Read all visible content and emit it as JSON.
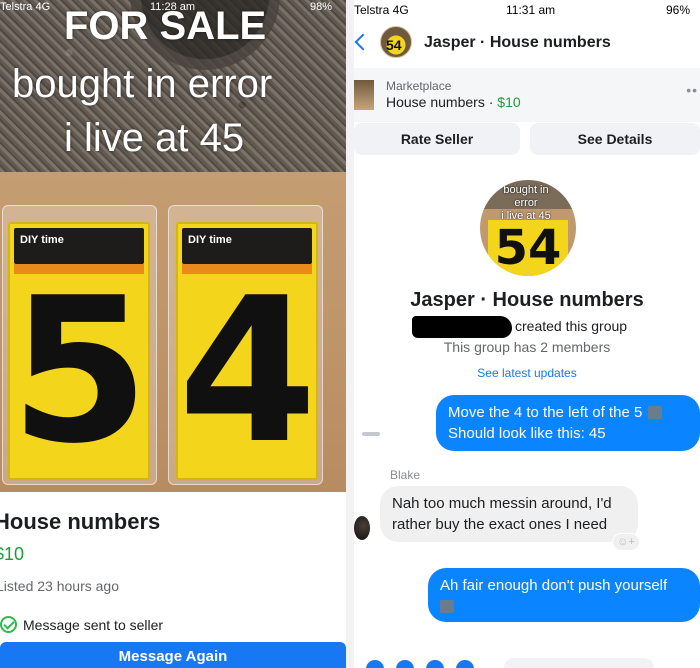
{
  "left": {
    "status": {
      "carrier": "Telstra 4G",
      "time": "11:28 am",
      "battery": "98%"
    },
    "photo_overlay": {
      "line1": "FOR SALE",
      "line2": "bought in error",
      "line3": "i live at 45"
    },
    "packs": [
      {
        "brand": "DIY time",
        "digit": "5"
      },
      {
        "brand": "DIY time",
        "digit": "4"
      }
    ],
    "listing": {
      "title": "House numbers",
      "price": "$10",
      "listed": "Listed 23 hours ago",
      "sent_status": "Message sent to seller",
      "message_again_label": "Message Again"
    }
  },
  "right": {
    "status": {
      "carrier": "Telstra 4G",
      "time": "11:31 am",
      "battery": "96%"
    },
    "header": {
      "title": "Jasper · House numbers"
    },
    "marketplace": {
      "label": "Marketplace",
      "item": "House numbers",
      "separator": "·",
      "price": "$10"
    },
    "buttons": {
      "rate_seller": "Rate Seller",
      "see_details": "See Details"
    },
    "group_avatar_text": {
      "line1": "bought in error",
      "line2": "i live at 45",
      "digits": "54"
    },
    "group": {
      "name": "Jasper · House numbers",
      "created": "created this group",
      "members": "This group has 2 members",
      "updates": "See latest updates"
    },
    "messages": [
      {
        "from": "me",
        "lines": [
          "Move the 4 to the left of the 5",
          "Should look like this: 45"
        ]
      },
      {
        "from": "Blake",
        "sender_label": "Blake",
        "lines": [
          "Nah too much messin around, I'd",
          "rather buy the exact ones I need"
        ]
      },
      {
        "from": "me",
        "lines": [
          "Ah fair enough don't push yourself"
        ]
      }
    ]
  }
}
